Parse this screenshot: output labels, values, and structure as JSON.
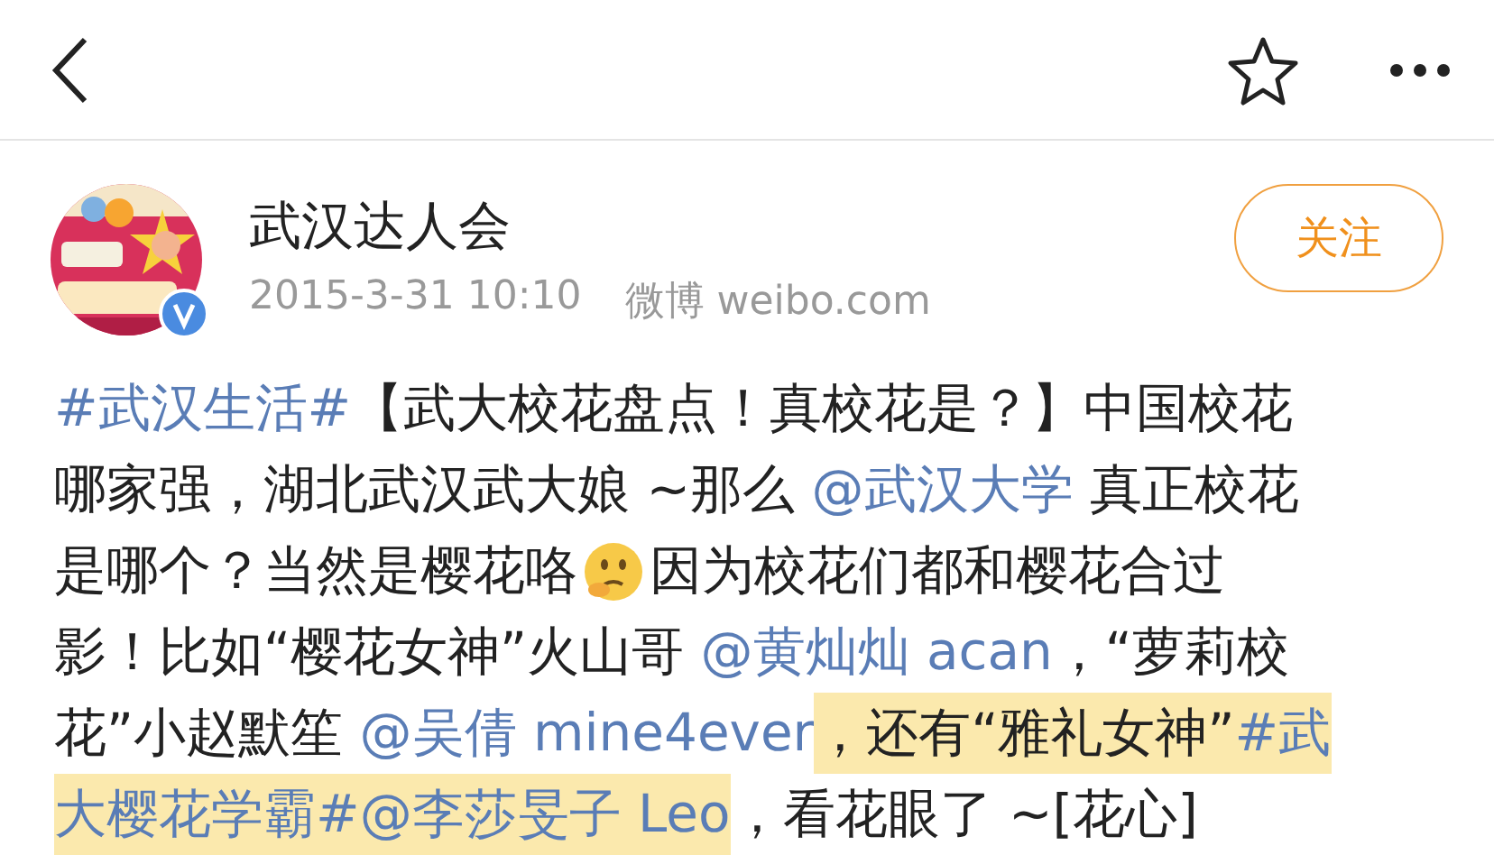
{
  "post": {
    "author": "武汉达人会",
    "verified": true,
    "time": "2015-3-31 10:10",
    "source": "微博 weibo.com",
    "follow_button": "关注",
    "lines": [
      [
        {
          "kind": "link",
          "text": "#武汉生活#",
          "highlighted": false
        },
        {
          "kind": "text",
          "text": "【武大校花盘点！真校花是？】中国校花",
          "highlighted": false
        }
      ],
      [
        {
          "kind": "text",
          "text": "哪家强，湖北武汉武大娘 ~那么 ",
          "highlighted": false
        },
        {
          "kind": "link",
          "text": "@武汉大学",
          "highlighted": false
        },
        {
          "kind": "text",
          "text": " 真正校花",
          "highlighted": false
        }
      ],
      [
        {
          "kind": "text",
          "text": "是哪个？当然是樱花咯",
          "highlighted": false
        },
        {
          "kind": "emoji",
          "highlighted": false
        },
        {
          "kind": "text",
          "text": "因为校花们都和樱花合过",
          "highlighted": false
        }
      ],
      [
        {
          "kind": "text",
          "text": "影！比如“樱花女神”火山哥 ",
          "highlighted": false
        },
        {
          "kind": "link",
          "text": "@黄灿灿 acan",
          "highlighted": false
        },
        {
          "kind": "text",
          "text": "，“萝莉校",
          "highlighted": false
        }
      ],
      [
        {
          "kind": "text",
          "text": "花”小赵默笙 ",
          "highlighted": false
        },
        {
          "kind": "link",
          "text": "@吴倩 mine4ever",
          "highlighted": false
        },
        {
          "kind": "text",
          "text": "，还有“雅礼女神”",
          "highlighted": true
        },
        {
          "kind": "link",
          "text": "#武",
          "highlighted": true
        }
      ],
      [
        {
          "kind": "link",
          "text": "大樱花学霸#",
          "highlighted": true
        },
        {
          "kind": "link",
          "text": "@李莎旻子 Leo",
          "highlighted": true
        },
        {
          "kind": "text",
          "text": "，看花眼了 ~[花心]",
          "highlighted": false
        }
      ]
    ]
  }
}
